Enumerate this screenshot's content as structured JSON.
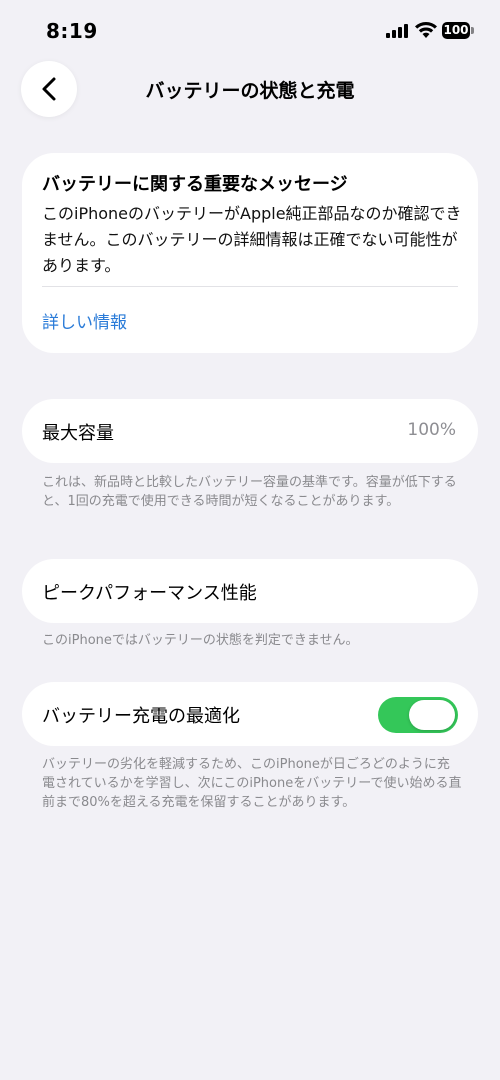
{
  "status_bar": {
    "time": "8:19",
    "battery": "100"
  },
  "nav": {
    "title": "バッテリーの状態と充電"
  },
  "message_card": {
    "title": "バッテリーに関する重要なメッセージ",
    "body": "このiPhoneのバッテリーがApple純正部品なのか確認できません。このバッテリーの詳細情報は正確でない可能性があります。",
    "link": "詳しい情報"
  },
  "max_capacity": {
    "label": "最大容量",
    "value": "100%",
    "footnote": "これは、新品時と比較したバッテリー容量の基準です。容量が低下すると、1回の充電で使用できる時間が短くなることがあります。"
  },
  "peak_performance": {
    "label": "ピークパフォーマンス性能",
    "footnote": "このiPhoneではバッテリーの状態を判定できません。"
  },
  "optimized_charging": {
    "label": "バッテリー充電の最適化",
    "enabled": true,
    "footnote": "バッテリーの劣化を軽減するため、このiPhoneが日ごろどのように充電されているかを学習し、次にこのiPhoneをバッテリーで使い始める直前まで80%を超える充電を保留することがあります。"
  },
  "colors": {
    "background": "#F2F1F6",
    "link": "#2A7BD8",
    "toggle_on": "#34C759",
    "secondary_text": "#8E8E93"
  }
}
